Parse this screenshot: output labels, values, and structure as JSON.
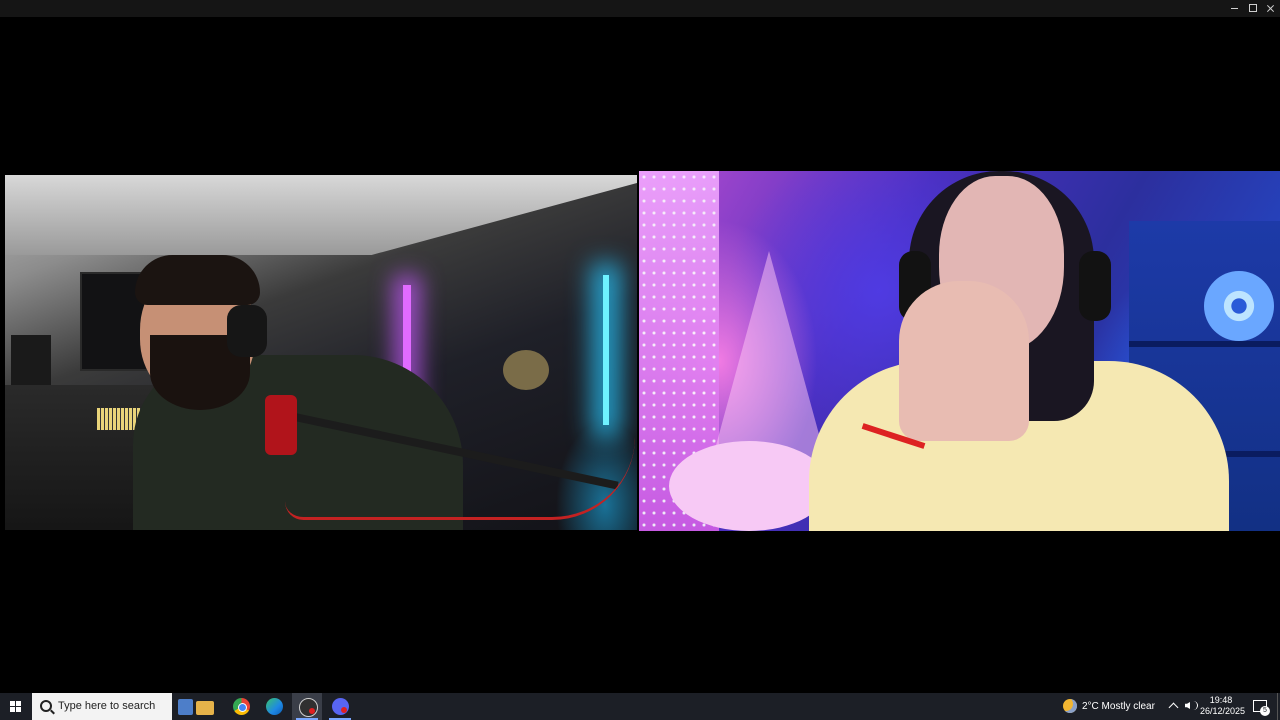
{
  "window": {
    "minimize_icon": "minimize-icon",
    "maximize_icon": "maximize-icon",
    "close_icon": "close-icon"
  },
  "videos": {
    "left_participant": "video-feed",
    "right_participant": "video-feed"
  },
  "taskbar": {
    "start_icon": "windows-logo-icon",
    "search_placeholder": "Type here to search",
    "apps": [
      {
        "name": "widgets",
        "icon": "shopping-bag-icon"
      },
      {
        "name": "chrome",
        "icon": "chrome-icon"
      },
      {
        "name": "edge",
        "icon": "edge-icon"
      },
      {
        "name": "obs",
        "icon": "obs-icon",
        "active": true
      },
      {
        "name": "discord",
        "icon": "discord-icon",
        "active": true
      }
    ],
    "weather": {
      "icon": "partly-cloudy-night-icon",
      "text": "2°C  Mostly clear"
    },
    "clock": {
      "time": "19:48",
      "date": "26/12/2025"
    },
    "notifications_count": "5",
    "colors": {
      "taskbar_bg": "#1c1f26",
      "active_indicator": "#7aa7ff"
    }
  }
}
